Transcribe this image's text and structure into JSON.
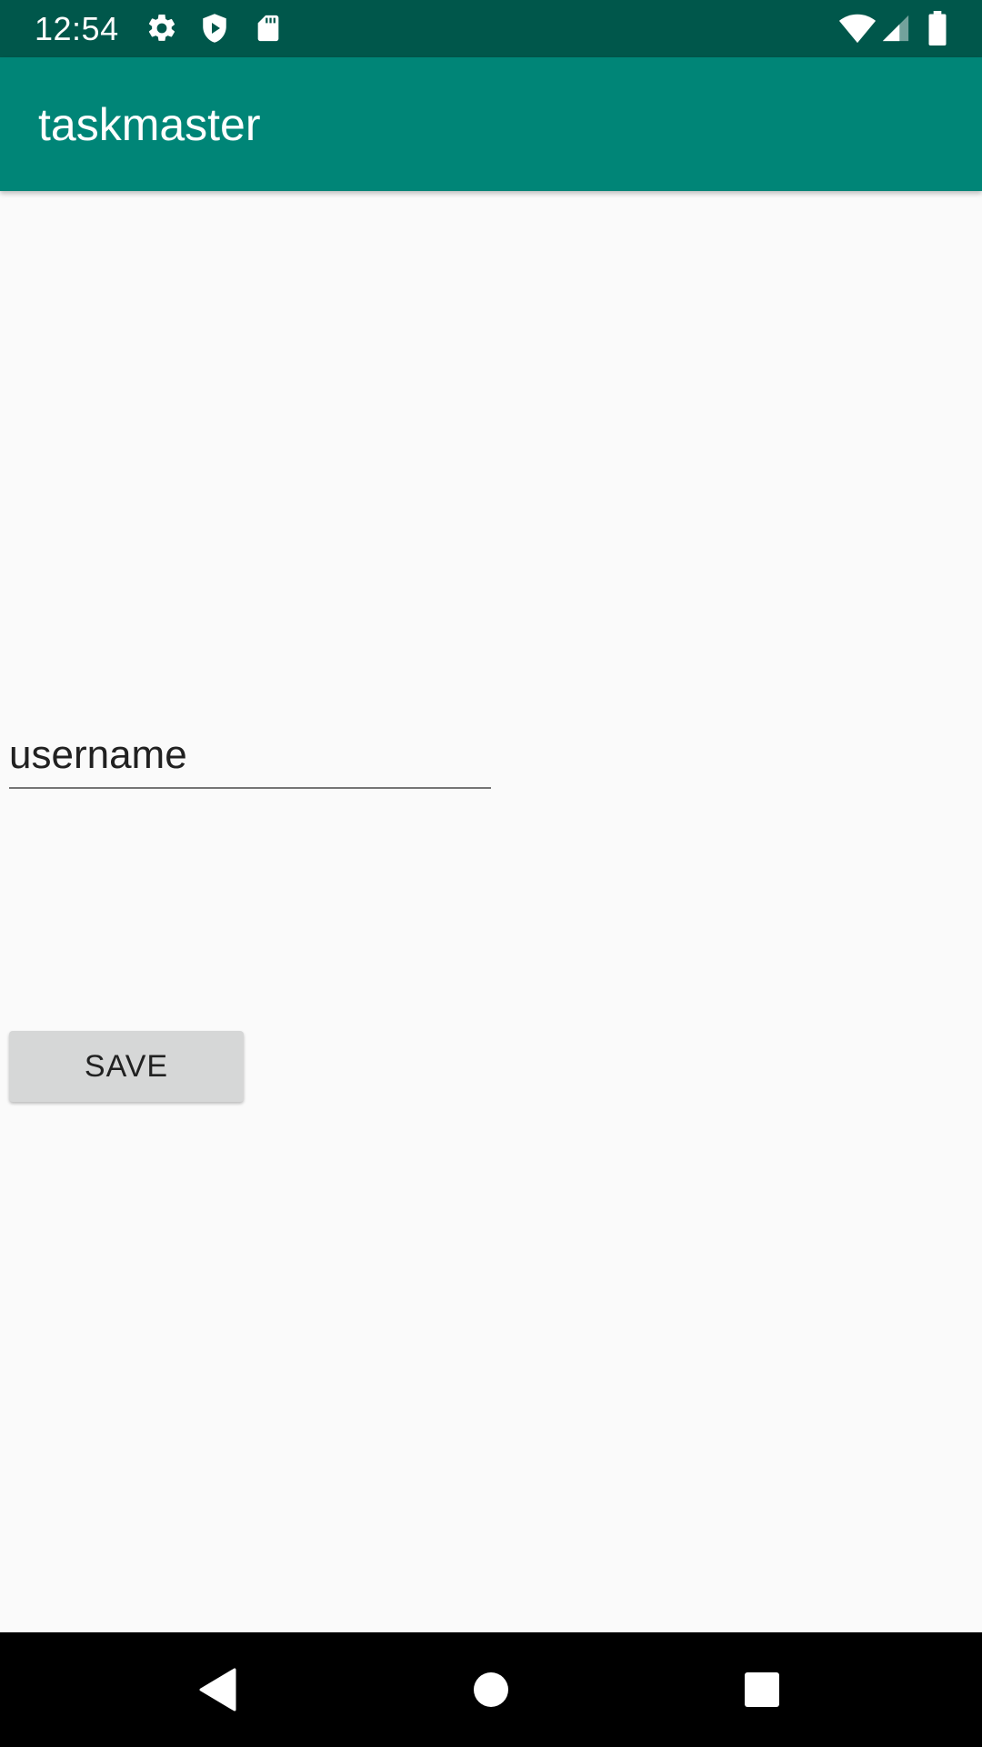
{
  "status_bar": {
    "time": "12:54",
    "left_icons": [
      "gear-icon",
      "shield-play-icon",
      "sd-card-icon"
    ],
    "right_icons": [
      "wifi-icon",
      "cell-signal-icon",
      "battery-icon"
    ]
  },
  "app_bar": {
    "title": "taskmaster",
    "color": "#008577",
    "status_color": "#00574b"
  },
  "form": {
    "username_placeholder": "username",
    "username_value": "",
    "save_label": "SAVE"
  },
  "nav_bar": {
    "buttons": [
      "back-icon",
      "home-icon",
      "recents-icon"
    ]
  }
}
